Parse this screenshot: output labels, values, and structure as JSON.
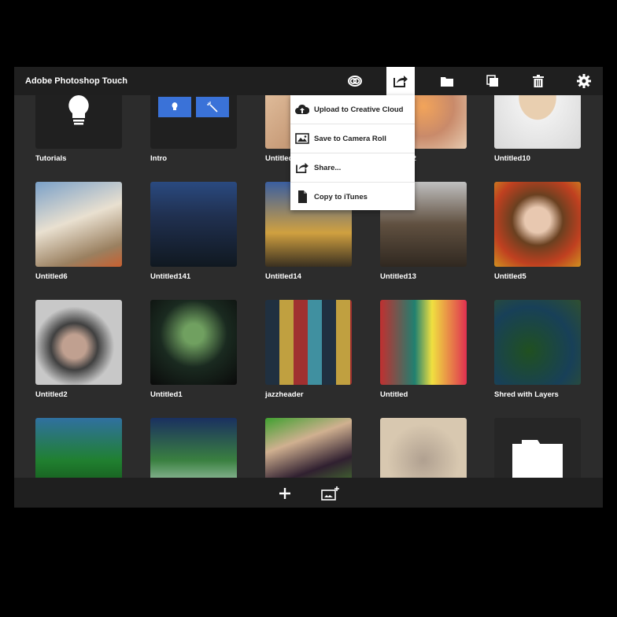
{
  "header": {
    "title": "Adobe Photoshop Touch",
    "icons": [
      "creative-cloud-icon",
      "share-icon",
      "folder-icon",
      "duplicate-icon",
      "trash-icon",
      "gear-icon"
    ]
  },
  "share_menu": {
    "items": [
      {
        "label": "Upload to Creative Cloud",
        "icon": "cloud-upload-icon"
      },
      {
        "label": "Save to Camera Roll",
        "icon": "image-icon"
      },
      {
        "label": "Share...",
        "icon": "share-icon"
      },
      {
        "label": "Copy to iTunes",
        "icon": "document-icon"
      }
    ]
  },
  "projects": [
    {
      "label": "Tutorials"
    },
    {
      "label": "Intro"
    },
    {
      "label": "Untitled"
    },
    {
      "label": "Untitled12"
    },
    {
      "label": "Untitled10"
    },
    {
      "label": "Untitled6"
    },
    {
      "label": "Untitled141"
    },
    {
      "label": "Untitled14"
    },
    {
      "label": "Untitled13"
    },
    {
      "label": "Untitled5"
    },
    {
      "label": "Untitled2"
    },
    {
      "label": "Untitled1"
    },
    {
      "label": "jazzheader"
    },
    {
      "label": "Untitled"
    },
    {
      "label": "Shred with Layers"
    },
    {
      "label": ""
    },
    {
      "label": ""
    },
    {
      "label": ""
    },
    {
      "label": ""
    },
    {
      "label": ""
    }
  ],
  "bottom": {
    "icons": [
      "add-icon",
      "add-image-icon"
    ]
  },
  "colors": {
    "accent_blue": "#3a72d8",
    "header": "#1f1f1f",
    "background": "#2c2c2c"
  }
}
